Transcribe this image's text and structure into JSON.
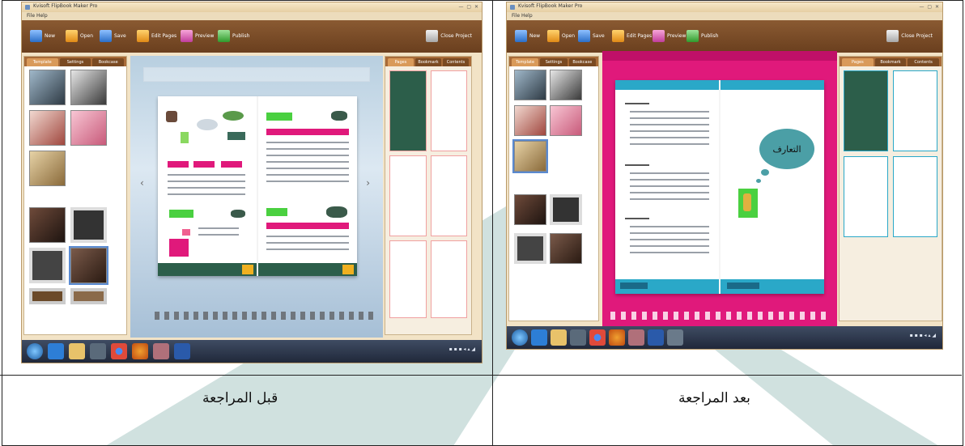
{
  "captions": {
    "left": "قبل المراجعة",
    "right": "بعد المراجعة"
  },
  "screens": {
    "before": {
      "title": "Kvisoft FlipBook Maker Pro",
      "menu": "File  Help",
      "toolbar": [
        "New",
        "Open",
        "Save",
        "Edit Pages",
        "Preview",
        "Publish"
      ],
      "close_project": "Close Project",
      "left_tabs": [
        "Template",
        "Settings",
        "Bookcase"
      ],
      "right_tabs": [
        "Pages",
        "Bookmark",
        "Contents"
      ]
    },
    "after": {
      "title": "Kvisoft FlipBook Maker Pro",
      "menu": "File  Help",
      "toolbar": [
        "New",
        "Open",
        "Save",
        "Edit Pages",
        "Preview",
        "Publish"
      ],
      "close_project": "Close Project",
      "left_tabs": [
        "Template",
        "Settings",
        "Bookcase"
      ],
      "right_tabs": [
        "Pages",
        "Bookmark",
        "Contents"
      ],
      "bubble_text": "التعارف"
    }
  },
  "colors": {
    "watermark": "#a9c9c4",
    "toolbar": "#7a4a22",
    "magenta_bg": "#e0197b",
    "teal_header": "#2aa8c8",
    "book_green": "#2c5e4a"
  }
}
